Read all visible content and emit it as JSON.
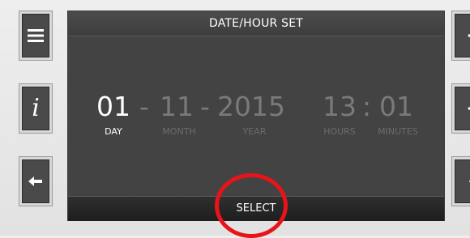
{
  "screen": {
    "title": "DATE/HOUR SET",
    "fields": {
      "day": {
        "value": "01",
        "label": "DAY"
      },
      "month": {
        "value": "11",
        "label": "MONTH"
      },
      "year": {
        "value": "2015",
        "label": "YEAR"
      },
      "hours": {
        "value": "13",
        "label": "HOURS"
      },
      "minutes": {
        "value": "01",
        "label": "MINUTES"
      }
    },
    "date_separator": "-",
    "time_separator": ":",
    "select_label": "SELECT"
  },
  "buttons": {
    "left": [
      "menu-icon",
      "info-icon",
      "back-icon"
    ],
    "right": [
      "plus-icon",
      "minus-icon",
      "enter-icon"
    ],
    "info_glyph": "i"
  },
  "colors": {
    "screen_bg": "#434343",
    "active_text": "#ffffff",
    "inactive_text": "#7a7a7a",
    "highlight_circle": "#e8141a"
  }
}
